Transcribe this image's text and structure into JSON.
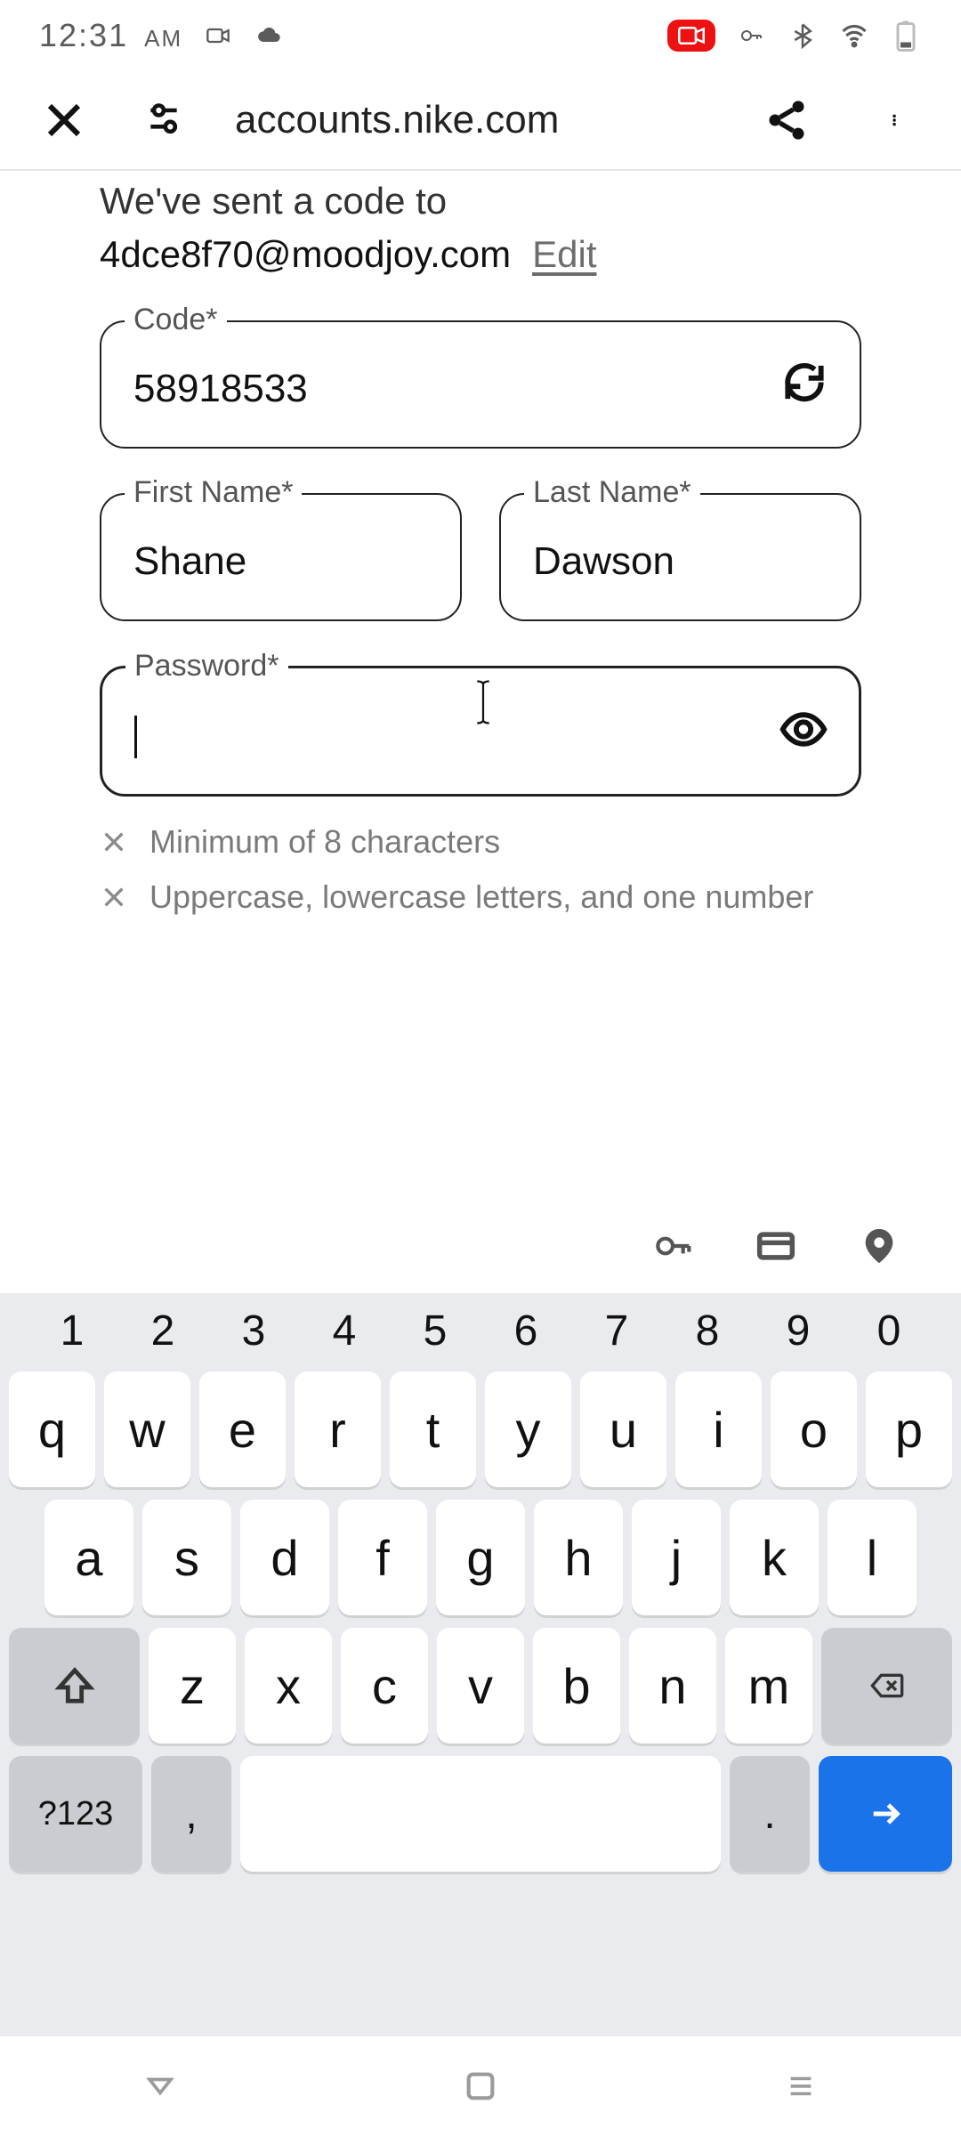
{
  "status": {
    "time": "12:31",
    "ampm": "AM"
  },
  "chrome": {
    "url": "accounts.nike.com"
  },
  "page": {
    "sent_msg": "We've sent a code to",
    "email": "4dce8f70@moodjoy.com",
    "edit": "Edit",
    "code_label": "Code*",
    "code_value": "58918533",
    "first_name_label": "First Name*",
    "first_name_value": "Shane",
    "last_name_label": "Last Name*",
    "last_name_value": "Dawson",
    "password_label": "Password*",
    "password_value": "",
    "req1": "Minimum of 8 characters",
    "req2": "Uppercase, lowercase letters, and one number"
  },
  "keyboard": {
    "nums": [
      "1",
      "2",
      "3",
      "4",
      "5",
      "6",
      "7",
      "8",
      "9",
      "0"
    ],
    "row1": [
      "q",
      "w",
      "e",
      "r",
      "t",
      "y",
      "u",
      "i",
      "o",
      "p"
    ],
    "row2": [
      "a",
      "s",
      "d",
      "f",
      "g",
      "h",
      "j",
      "k",
      "l"
    ],
    "row3": [
      "z",
      "x",
      "c",
      "v",
      "b",
      "n",
      "m"
    ],
    "sym": "?123",
    "comma": ",",
    "period": "."
  }
}
